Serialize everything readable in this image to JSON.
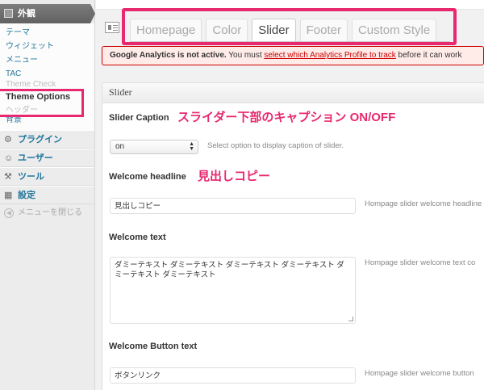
{
  "sidebar": {
    "active_menu": {
      "label": "外観",
      "icon": "appearance-icon"
    },
    "submenu": [
      {
        "label": "テーマ"
      },
      {
        "label": "ウィジェット"
      },
      {
        "label": "メニュー"
      },
      {
        "label": "TAC"
      },
      {
        "label": "Theme Check"
      },
      {
        "label": "Theme Options"
      },
      {
        "label": "ヘッダー"
      },
      {
        "label": "背景"
      }
    ],
    "menus": [
      {
        "label": "プラグイン",
        "icon": "plugin-icon"
      },
      {
        "label": "ユーザー",
        "icon": "users-icon"
      },
      {
        "label": "ツール",
        "icon": "tools-icon"
      },
      {
        "label": "設定",
        "icon": "settings-icon"
      }
    ],
    "collapse_label": "メニューを閉じる"
  },
  "tabs": [
    {
      "label": "Homepage"
    },
    {
      "label": "Color"
    },
    {
      "label": "Slider"
    },
    {
      "label": "Footer"
    },
    {
      "label": "Custom Style"
    }
  ],
  "notice": {
    "bold": "Google Analytics is not active.",
    "text1": " You must ",
    "link": "select which Analytics Profile to track",
    "text2": " before it can work"
  },
  "panel": {
    "title": "Slider",
    "slider_caption": {
      "label": "Slider Caption",
      "select_value": "on",
      "desc": "Select option to display caption of slider.",
      "annotation": "スライダー下部のキャプション ON/OFF"
    },
    "welcome_headline": {
      "label": "Welcome headline",
      "value": "見出しコピー",
      "desc": "Hompage slider welcome headline",
      "annotation": "見出しコピー"
    },
    "welcome_text": {
      "label": "Welcome text",
      "value": "ダミーテキスト ダミーテキスト ダミーテキスト ダミーテキスト ダミーテキスト ダミーテキスト",
      "desc": "Hompage slider welcome text co"
    },
    "welcome_button": {
      "label": "Welcome Button text",
      "value": "ボタンリンク",
      "desc": "Hompage slider welcome button"
    }
  },
  "colors": {
    "highlight": "#e8296f",
    "link": "#21759b",
    "notice_border": "#cc0000"
  }
}
